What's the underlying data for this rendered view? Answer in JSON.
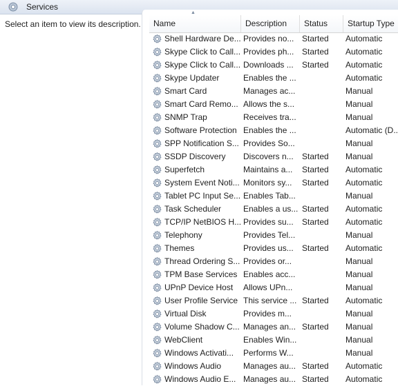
{
  "window": {
    "title": "Services"
  },
  "description_pane": {
    "text": "Select an item to view its description."
  },
  "columns": [
    "Name",
    "Description",
    "Status",
    "Startup Type"
  ],
  "services": [
    {
      "name": "Shell Hardware De...",
      "description": "Provides no...",
      "status": "Started",
      "startup": "Automatic"
    },
    {
      "name": "Skype Click to Call...",
      "description": "Provides ph...",
      "status": "Started",
      "startup": "Automatic"
    },
    {
      "name": "Skype Click to Call...",
      "description": "Downloads ...",
      "status": "Started",
      "startup": "Automatic"
    },
    {
      "name": "Skype Updater",
      "description": "Enables the ...",
      "status": "",
      "startup": "Automatic"
    },
    {
      "name": "Smart Card",
      "description": "Manages ac...",
      "status": "",
      "startup": "Manual"
    },
    {
      "name": "Smart Card Remo...",
      "description": "Allows the s...",
      "status": "",
      "startup": "Manual"
    },
    {
      "name": "SNMP Trap",
      "description": "Receives tra...",
      "status": "",
      "startup": "Manual"
    },
    {
      "name": "Software Protection",
      "description": "Enables the ...",
      "status": "",
      "startup": "Automatic (D..."
    },
    {
      "name": "SPP Notification S...",
      "description": "Provides So...",
      "status": "",
      "startup": "Manual"
    },
    {
      "name": "SSDP Discovery",
      "description": "Discovers n...",
      "status": "Started",
      "startup": "Manual"
    },
    {
      "name": "Superfetch",
      "description": "Maintains a...",
      "status": "Started",
      "startup": "Automatic"
    },
    {
      "name": "System Event Noti...",
      "description": "Monitors sy...",
      "status": "Started",
      "startup": "Automatic"
    },
    {
      "name": "Tablet PC Input Se...",
      "description": "Enables Tab...",
      "status": "",
      "startup": "Manual"
    },
    {
      "name": "Task Scheduler",
      "description": "Enables a us...",
      "status": "Started",
      "startup": "Automatic"
    },
    {
      "name": "TCP/IP NetBIOS H...",
      "description": "Provides su...",
      "status": "Started",
      "startup": "Automatic"
    },
    {
      "name": "Telephony",
      "description": "Provides Tel...",
      "status": "",
      "startup": "Manual"
    },
    {
      "name": "Themes",
      "description": "Provides us...",
      "status": "Started",
      "startup": "Automatic"
    },
    {
      "name": "Thread Ordering S...",
      "description": "Provides or...",
      "status": "",
      "startup": "Manual"
    },
    {
      "name": "TPM Base Services",
      "description": "Enables acc...",
      "status": "",
      "startup": "Manual"
    },
    {
      "name": "UPnP Device Host",
      "description": "Allows UPn...",
      "status": "",
      "startup": "Manual"
    },
    {
      "name": "User Profile Service",
      "description": "This service ...",
      "status": "Started",
      "startup": "Automatic"
    },
    {
      "name": "Virtual Disk",
      "description": "Provides m...",
      "status": "",
      "startup": "Manual"
    },
    {
      "name": "Volume Shadow C...",
      "description": "Manages an...",
      "status": "Started",
      "startup": "Manual"
    },
    {
      "name": "WebClient",
      "description": "Enables Win...",
      "status": "",
      "startup": "Manual"
    },
    {
      "name": "Windows Activati...",
      "description": "Performs W...",
      "status": "",
      "startup": "Manual"
    },
    {
      "name": "Windows Audio",
      "description": "Manages au...",
      "status": "Started",
      "startup": "Automatic"
    },
    {
      "name": "Windows Audio E...",
      "description": "Manages au...",
      "status": "Started",
      "startup": "Automatic"
    }
  ],
  "icons": {
    "title": "services-gear-icon",
    "row": "service-gear-icon",
    "sort": "sort-ascending-icon"
  }
}
